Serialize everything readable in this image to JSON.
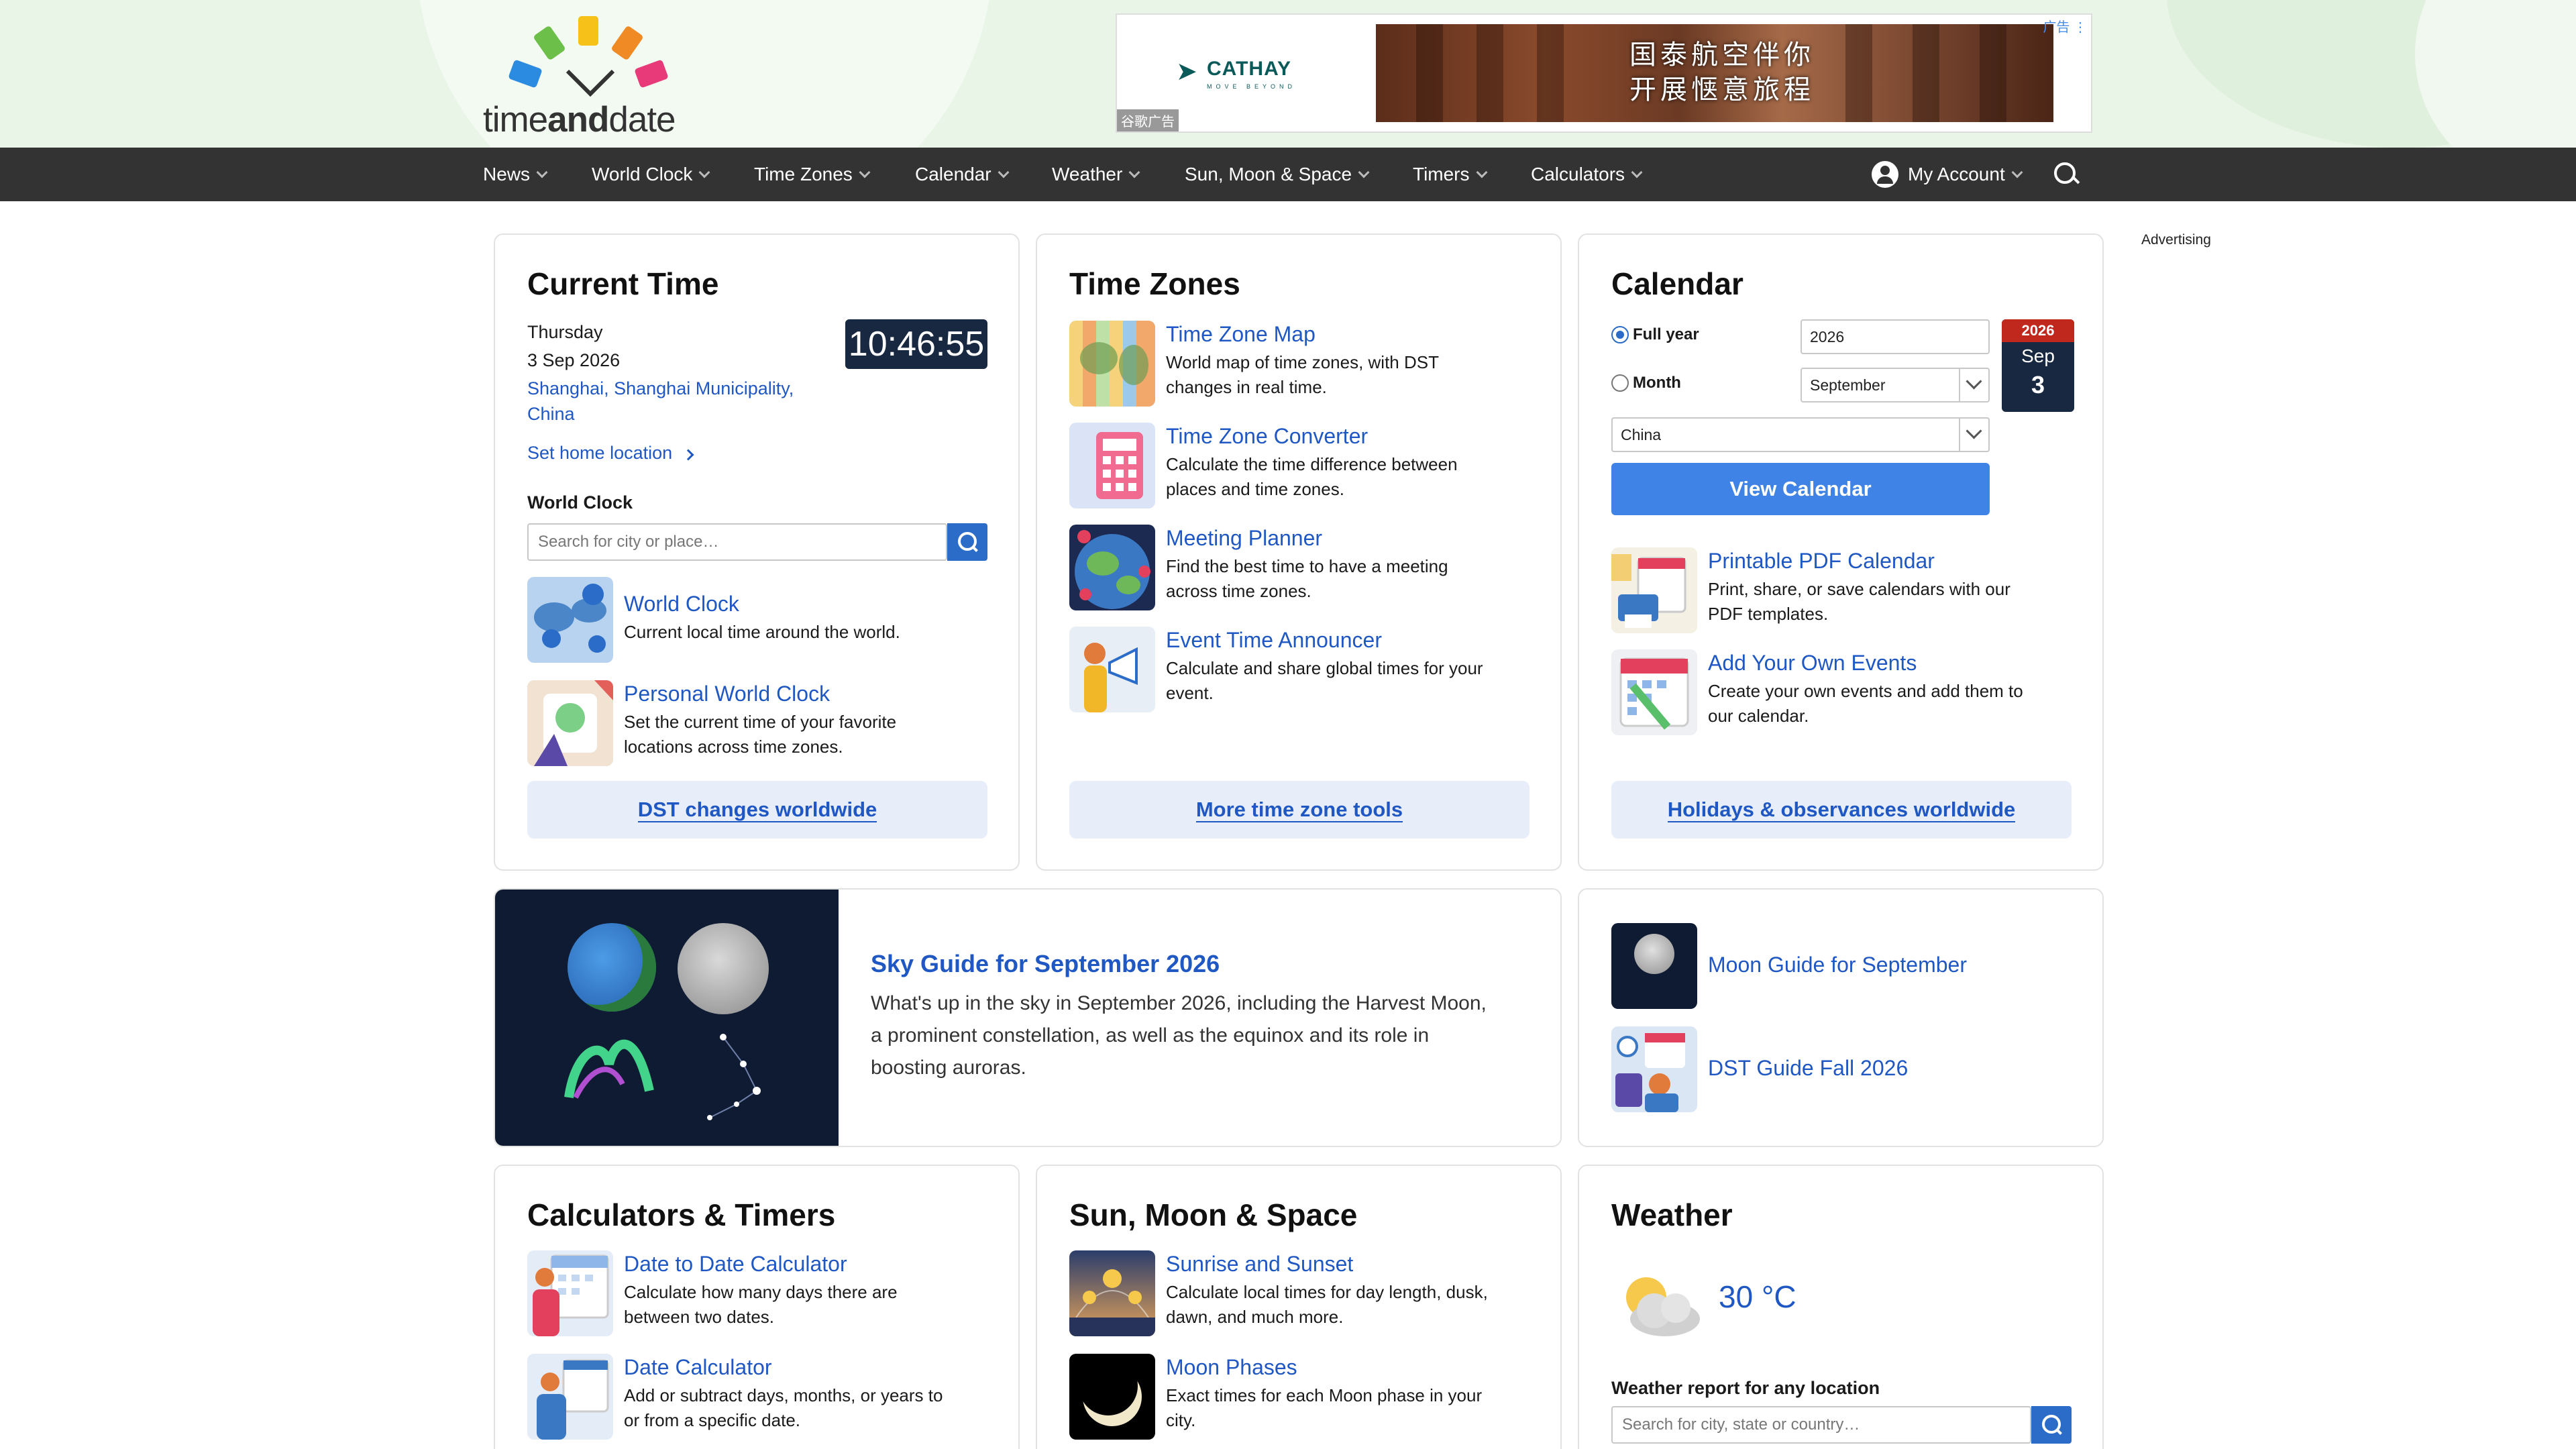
{
  "brand": {
    "name_part1": "time",
    "name_part2": "and",
    "name_part3": "date"
  },
  "ad": {
    "brand": "CATHAY",
    "tagline": "MOVE BEYOND",
    "headline_line1": "国泰航空伴你",
    "headline_line2": "开展惬意旅程",
    "label": "谷歌广告",
    "corner": "广告 ⋮"
  },
  "nav": {
    "items": [
      "News",
      "World Clock",
      "Time Zones",
      "Calendar",
      "Weather",
      "Sun, Moon & Space",
      "Timers",
      "Calculators"
    ],
    "account": "My Account"
  },
  "advertising_label": "Advertising",
  "current_time": {
    "title": "Current Time",
    "day": "Thursday",
    "date": "3 Sep 2026",
    "location_line1": "Shanghai, Shanghai Municipality,",
    "location_line2": "China",
    "clock": "10:46:55",
    "set_home": "Set home location",
    "world_clock_label": "World Clock",
    "search_placeholder": "Search for city or place…",
    "items": [
      {
        "title": "World Clock",
        "desc_line1": "Current local time around the world.",
        "desc_line2": ""
      },
      {
        "title": "Personal World Clock",
        "desc_line1": "Set the current time of your favorite",
        "desc_line2": "locations across time zones."
      }
    ],
    "footer": "DST changes worldwide"
  },
  "time_zones": {
    "title": "Time Zones",
    "items": [
      {
        "title": "Time Zone Map",
        "desc_line1": "World map of time zones, with DST",
        "desc_line2": "changes in real time."
      },
      {
        "title": "Time Zone Converter",
        "desc_line1": "Calculate the time difference between",
        "desc_line2": "places and time zones."
      },
      {
        "title": "Meeting Planner",
        "desc_line1": "Find the best time to have a meeting",
        "desc_line2": "across time zones."
      },
      {
        "title": "Event Time Announcer",
        "desc_line1": "Calculate and share global times for your",
        "desc_line2": "event."
      }
    ],
    "footer": "More time zone tools"
  },
  "calendar": {
    "title": "Calendar",
    "full_year_label": "Full year",
    "month_label": "Month",
    "year_value": "2026",
    "month_value": "September",
    "country_value": "China",
    "badge": {
      "year": "2026",
      "month": "Sep",
      "day": "3"
    },
    "view_button": "View Calendar",
    "items": [
      {
        "title": "Printable PDF Calendar",
        "desc_line1": "Print, share, or save calendars with our",
        "desc_line2": "PDF templates."
      },
      {
        "title": "Add Your Own Events",
        "desc_line1": "Create your own events and add them to",
        "desc_line2": "our calendar."
      }
    ],
    "footer": "Holidays & observances worldwide"
  },
  "sky_guide": {
    "title": "Sky Guide for September 2026",
    "desc_line1": "What's up in the sky in September 2026, including the Harvest Moon,",
    "desc_line2": "a prominent constellation, as well as the equinox and its role in",
    "desc_line3": "boosting auroras."
  },
  "guides": {
    "items": [
      {
        "title": "Moon Guide for September"
      },
      {
        "title": "DST Guide Fall 2026"
      }
    ]
  },
  "calculators": {
    "title": "Calculators & Timers",
    "items": [
      {
        "title": "Date to Date Calculator",
        "desc_line1": "Calculate how many days there are",
        "desc_line2": "between two dates."
      },
      {
        "title": "Date Calculator",
        "desc_line1": "Add or subtract days, months, or years to",
        "desc_line2": "or from a specific date."
      }
    ]
  },
  "sun_moon": {
    "title": "Sun, Moon & Space",
    "items": [
      {
        "title": "Sunrise and Sunset",
        "desc_line1": "Calculate local times for day length, dusk,",
        "desc_line2": "dawn, and much more."
      },
      {
        "title": "Moon Phases",
        "desc_line1": "Exact times for each Moon phase in your",
        "desc_line2": "city."
      }
    ]
  },
  "weather": {
    "title": "Weather",
    "temperature": "30 °C",
    "report_label": "Weather report for any location",
    "search_placeholder": "Search for city, state or country…"
  }
}
